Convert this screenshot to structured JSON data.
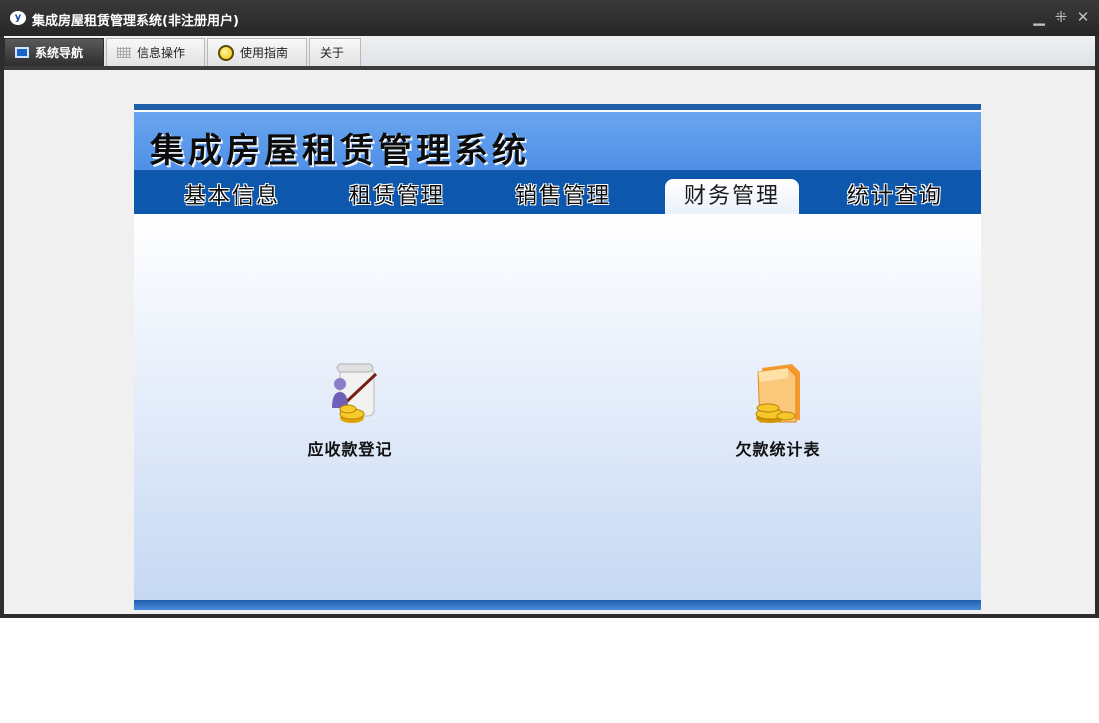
{
  "window": {
    "title": "集成房屋租赁管理系统(非注册用户)",
    "app_icon": "ys-logo-icon",
    "controls": [
      "minimize-icon",
      "restore-icon",
      "close-icon"
    ]
  },
  "tabs": [
    {
      "label": "系统导航",
      "icon": "monitor-icon",
      "active": true
    },
    {
      "label": "信息操作",
      "icon": "grid-icon",
      "active": false
    },
    {
      "label": "使用指南",
      "icon": "guide-icon",
      "active": false
    },
    {
      "label": "关于",
      "icon": "",
      "active": false
    }
  ],
  "banner": {
    "title": "集成房屋租赁管理系统"
  },
  "nav": [
    {
      "label": "基本信息",
      "active": false
    },
    {
      "label": "租赁管理",
      "active": false
    },
    {
      "label": "销售管理",
      "active": false
    },
    {
      "label": "财务管理",
      "active": true
    },
    {
      "label": "统计查询",
      "active": false
    }
  ],
  "actions": [
    {
      "label": "应收款登记",
      "icon": "receivable-register-icon"
    },
    {
      "label": "欠款统计表",
      "icon": "arrears-report-icon"
    }
  ],
  "colors": {
    "accent": "#0d58ad",
    "banner": "#5a98ea",
    "titlebar": "#2d2d2d"
  }
}
